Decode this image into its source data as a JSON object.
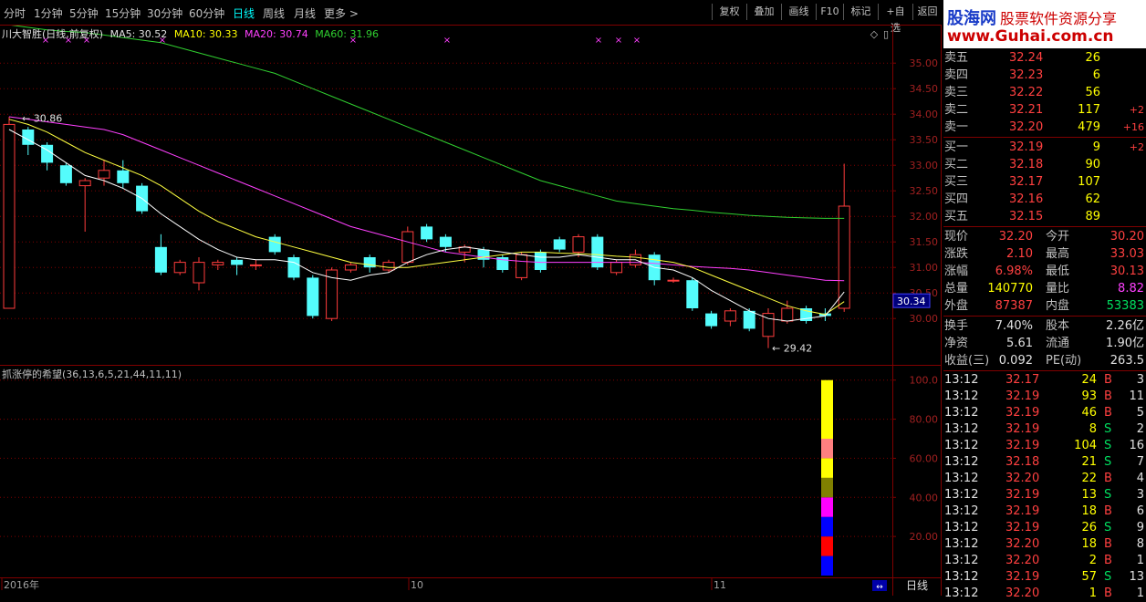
{
  "toolbar": {
    "tabs": [
      {
        "label": "分时"
      },
      {
        "label": "1分钟"
      },
      {
        "label": "5分钟"
      },
      {
        "label": "15分钟"
      },
      {
        "label": "30分钟"
      },
      {
        "label": "60分钟"
      },
      {
        "label": "日线"
      },
      {
        "label": "周线"
      },
      {
        "label": "月线"
      },
      {
        "label": "更多 >"
      }
    ],
    "active": "日线",
    "buttons": [
      {
        "label": "复权"
      },
      {
        "label": "叠加"
      },
      {
        "label": "画线"
      },
      {
        "label": "F10"
      },
      {
        "label": "标记"
      },
      {
        "label": "+自选"
      },
      {
        "label": "返回"
      }
    ]
  },
  "logo": {
    "brand": "股海网",
    "slogan": "股票软件资源分享",
    "url": "www.Guhai.com.cn"
  },
  "legend": {
    "stock": "川大智胜(日线,前复权)",
    "ma5": "MA5: 30.52",
    "ma10": "MA10: 30.33",
    "ma20": "MA20: 30.74",
    "ma60": "MA60: 31.96"
  },
  "indicator": {
    "title": "抓涨停的希望(36,13,6,5,21,44,11,11)"
  },
  "status": {
    "period": "日线"
  },
  "colors": {
    "up": "#ff3c3c",
    "down": "#54fcfc",
    "ma5": "#ffffff",
    "ma10": "#ffff40",
    "ma20": "#ff40ff",
    "ma60": "#30d030",
    "grid": "#800000"
  },
  "chart_data": [
    {
      "type": "candlestick",
      "title": "川大智胜(日线,前复权)",
      "y_ticks": [
        30.0,
        30.5,
        31.0,
        31.5,
        32.0,
        32.5,
        33.0,
        33.5,
        34.0,
        34.5,
        35.0
      ],
      "y_range": [
        29.2,
        35.7
      ],
      "x_ticks": [
        "2016年",
        "10",
        "11"
      ],
      "current_price_label": "30.34",
      "annotations": [
        "30.86",
        "29.42"
      ],
      "candles": [
        [
          30.2,
          33.8,
          33.95,
          33.6
        ],
        [
          33.7,
          33.4,
          33.75,
          33.2
        ],
        [
          33.4,
          33.05,
          33.45,
          32.9
        ],
        [
          33.0,
          32.65,
          33.05,
          32.6
        ],
        [
          32.6,
          32.7,
          32.75,
          31.7
        ],
        [
          32.75,
          32.9,
          33.1,
          32.6
        ],
        [
          32.9,
          32.65,
          33.1,
          32.55
        ],
        [
          32.6,
          32.1,
          32.65,
          32.05
        ],
        [
          31.4,
          30.9,
          31.65,
          30.85
        ],
        [
          30.9,
          31.1,
          31.15,
          30.85
        ],
        [
          30.7,
          31.1,
          31.2,
          30.55
        ],
        [
          31.05,
          31.1,
          31.15,
          30.95
        ],
        [
          31.15,
          31.05,
          31.2,
          30.85
        ],
        [
          31.05,
          31.05,
          31.15,
          30.95
        ],
        [
          31.6,
          31.3,
          31.65,
          31.25
        ],
        [
          31.2,
          30.8,
          31.25,
          30.75
        ],
        [
          30.8,
          30.05,
          30.85,
          30.0
        ],
        [
          30.0,
          30.95,
          31.0,
          29.95
        ],
        [
          30.95,
          31.05,
          31.1,
          30.9
        ],
        [
          31.2,
          31.0,
          31.25,
          30.9
        ],
        [
          30.95,
          31.1,
          31.15,
          30.9
        ],
        [
          31.1,
          31.7,
          31.8,
          31.05
        ],
        [
          31.8,
          31.55,
          31.85,
          31.5
        ],
        [
          31.6,
          31.4,
          31.65,
          31.3
        ],
        [
          31.3,
          31.4,
          31.45,
          31.1
        ],
        [
          31.35,
          31.15,
          31.4,
          31.0
        ],
        [
          31.2,
          30.95,
          31.25,
          30.9
        ],
        [
          30.8,
          31.25,
          31.3,
          30.75
        ],
        [
          31.3,
          30.95,
          31.35,
          30.9
        ],
        [
          31.55,
          31.35,
          31.6,
          31.3
        ],
        [
          31.3,
          31.6,
          31.65,
          31.2
        ],
        [
          31.6,
          31.0,
          31.65,
          30.95
        ],
        [
          30.9,
          31.1,
          31.15,
          30.85
        ],
        [
          31.05,
          31.25,
          31.35,
          31.0
        ],
        [
          31.25,
          30.75,
          31.3,
          30.65
        ],
        [
          30.75,
          30.75,
          30.8,
          30.7
        ],
        [
          30.75,
          30.2,
          30.8,
          30.15
        ],
        [
          30.1,
          29.85,
          30.15,
          29.8
        ],
        [
          29.95,
          30.15,
          30.2,
          29.85
        ],
        [
          30.15,
          29.8,
          30.2,
          29.75
        ],
        [
          29.65,
          30.1,
          30.2,
          29.42
        ],
        [
          29.95,
          30.2,
          30.35,
          29.9
        ],
        [
          30.2,
          29.95,
          30.25,
          29.9
        ],
        [
          30.1,
          30.05,
          30.2,
          29.95
        ],
        [
          30.2,
          32.2,
          33.03,
          30.13
        ]
      ],
      "ma5": [
        33.7,
        33.5,
        33.3,
        33.05,
        32.8,
        32.7,
        32.55,
        32.35,
        32.05,
        31.8,
        31.55,
        31.35,
        31.2,
        31.15,
        31.15,
        31.1,
        30.9,
        30.8,
        30.75,
        30.85,
        30.9,
        31.1,
        31.25,
        31.35,
        31.4,
        31.35,
        31.3,
        31.25,
        31.2,
        31.2,
        31.25,
        31.2,
        31.15,
        31.15,
        31.0,
        30.95,
        30.8,
        30.55,
        30.35,
        30.15,
        30.0,
        29.95,
        30.0,
        30.05,
        30.52
      ],
      "ma10": [
        33.9,
        33.8,
        33.65,
        33.45,
        33.25,
        33.1,
        32.95,
        32.8,
        32.6,
        32.35,
        32.1,
        31.9,
        31.75,
        31.6,
        31.5,
        31.4,
        31.3,
        31.2,
        31.1,
        31.05,
        31.0,
        31.0,
        31.05,
        31.1,
        31.15,
        31.2,
        31.25,
        31.3,
        31.3,
        31.28,
        31.27,
        31.25,
        31.22,
        31.2,
        31.15,
        31.1,
        31.0,
        30.85,
        30.7,
        30.55,
        30.4,
        30.25,
        30.15,
        30.08,
        30.33
      ],
      "ma20": [
        33.95,
        33.9,
        33.85,
        33.8,
        33.75,
        33.7,
        33.6,
        33.45,
        33.3,
        33.15,
        33.0,
        32.85,
        32.7,
        32.55,
        32.4,
        32.25,
        32.1,
        31.95,
        31.8,
        31.7,
        31.6,
        31.5,
        31.4,
        31.3,
        31.25,
        31.2,
        31.15,
        31.12,
        31.1,
        31.1,
        31.1,
        31.1,
        31.1,
        31.1,
        31.08,
        31.05,
        31.02,
        31.0,
        30.98,
        30.95,
        30.9,
        30.85,
        30.8,
        30.75,
        30.74
      ],
      "ma60": [
        35.75,
        35.7,
        35.65,
        35.62,
        35.6,
        35.55,
        35.5,
        35.45,
        35.4,
        35.3,
        35.2,
        35.1,
        35.0,
        34.9,
        34.8,
        34.65,
        34.5,
        34.35,
        34.2,
        34.05,
        33.9,
        33.75,
        33.6,
        33.45,
        33.3,
        33.15,
        33.0,
        32.85,
        32.7,
        32.6,
        32.5,
        32.4,
        32.3,
        32.25,
        32.2,
        32.15,
        32.12,
        32.08,
        32.05,
        32.02,
        32.0,
        31.98,
        31.97,
        31.96,
        31.96
      ]
    },
    {
      "type": "bar",
      "title": "抓涨停的希望(36,13,6,5,21,44,11,11)",
      "y_ticks": [
        20.0,
        40.0,
        60.0,
        80.0,
        100.0
      ],
      "y_range": [
        0,
        105
      ],
      "stacked_bar": [
        {
          "from": 0,
          "to": 10,
          "color": "#0000ff"
        },
        {
          "from": 10,
          "to": 20,
          "color": "#ff0000"
        },
        {
          "from": 20,
          "to": 30,
          "color": "#0000ff"
        },
        {
          "from": 30,
          "to": 40,
          "color": "#ff00ff"
        },
        {
          "from": 40,
          "to": 50,
          "color": "#808000"
        },
        {
          "from": 50,
          "to": 60,
          "color": "#ffff00"
        },
        {
          "from": 60,
          "to": 70,
          "color": "#ff8080"
        },
        {
          "from": 70,
          "to": 100,
          "color": "#ffff00"
        }
      ]
    }
  ],
  "orderbook": {
    "asks": [
      {
        "label": "卖五",
        "price": "32.24",
        "vol": "26",
        "chg": ""
      },
      {
        "label": "卖四",
        "price": "32.23",
        "vol": "6",
        "chg": ""
      },
      {
        "label": "卖三",
        "price": "32.22",
        "vol": "56",
        "chg": ""
      },
      {
        "label": "卖二",
        "price": "32.21",
        "vol": "117",
        "chg": "+2"
      },
      {
        "label": "卖一",
        "price": "32.20",
        "vol": "479",
        "chg": "+16"
      }
    ],
    "bids": [
      {
        "label": "买一",
        "price": "32.19",
        "vol": "9",
        "chg": "+2"
      },
      {
        "label": "买二",
        "price": "32.18",
        "vol": "90",
        "chg": ""
      },
      {
        "label": "买三",
        "price": "32.17",
        "vol": "107",
        "chg": ""
      },
      {
        "label": "买四",
        "price": "32.16",
        "vol": "62",
        "chg": ""
      },
      {
        "label": "买五",
        "price": "32.15",
        "vol": "89",
        "chg": ""
      }
    ]
  },
  "quote": [
    {
      "l1": "现价",
      "v1": "32.20",
      "l2": "今开",
      "v2": "30.20"
    },
    {
      "l1": "涨跌",
      "v1": "2.10",
      "l2": "最高",
      "v2": "33.03"
    },
    {
      "l1": "涨幅",
      "v1": "6.98%",
      "l2": "最低",
      "v2": "30.13"
    },
    {
      "l1": "总量",
      "v1": "140770",
      "l2": "量比",
      "v2": "8.82"
    },
    {
      "l1": "外盘",
      "v1": "87387",
      "l2": "内盘",
      "v2": "53383"
    }
  ],
  "stats": [
    {
      "l1": "换手",
      "v1": "7.40%",
      "l2": "股本",
      "v2": "2.26亿"
    },
    {
      "l1": "净资",
      "v1": "5.61",
      "l2": "流通",
      "v2": "1.90亿"
    },
    {
      "l1": "收益(三)",
      "v1": "0.092",
      "l2": "PE(动)",
      "v2": "263.5"
    }
  ],
  "ticks": [
    {
      "time": "13:12",
      "price": "32.17",
      "vol": "24",
      "side": "B",
      "n": "3"
    },
    {
      "time": "13:12",
      "price": "32.19",
      "vol": "93",
      "side": "B",
      "n": "11"
    },
    {
      "time": "13:12",
      "price": "32.19",
      "vol": "46",
      "side": "B",
      "n": "5"
    },
    {
      "time": "13:12",
      "price": "32.19",
      "vol": "8",
      "side": "S",
      "n": "2"
    },
    {
      "time": "13:12",
      "price": "32.19",
      "vol": "104",
      "side": "S",
      "n": "16"
    },
    {
      "time": "13:12",
      "price": "32.18",
      "vol": "21",
      "side": "S",
      "n": "7"
    },
    {
      "time": "13:12",
      "price": "32.20",
      "vol": "22",
      "side": "B",
      "n": "4"
    },
    {
      "time": "13:12",
      "price": "32.19",
      "vol": "13",
      "side": "S",
      "n": "3"
    },
    {
      "time": "13:12",
      "price": "32.19",
      "vol": "18",
      "side": "B",
      "n": "6"
    },
    {
      "time": "13:12",
      "price": "32.19",
      "vol": "26",
      "side": "S",
      "n": "9"
    },
    {
      "time": "13:12",
      "price": "32.20",
      "vol": "18",
      "side": "B",
      "n": "8"
    },
    {
      "time": "13:12",
      "price": "32.20",
      "vol": "2",
      "side": "B",
      "n": "1"
    },
    {
      "time": "13:12",
      "price": "32.19",
      "vol": "57",
      "side": "S",
      "n": "13"
    },
    {
      "time": "13:12",
      "price": "32.20",
      "vol": "1",
      "side": "B",
      "n": "1"
    }
  ]
}
